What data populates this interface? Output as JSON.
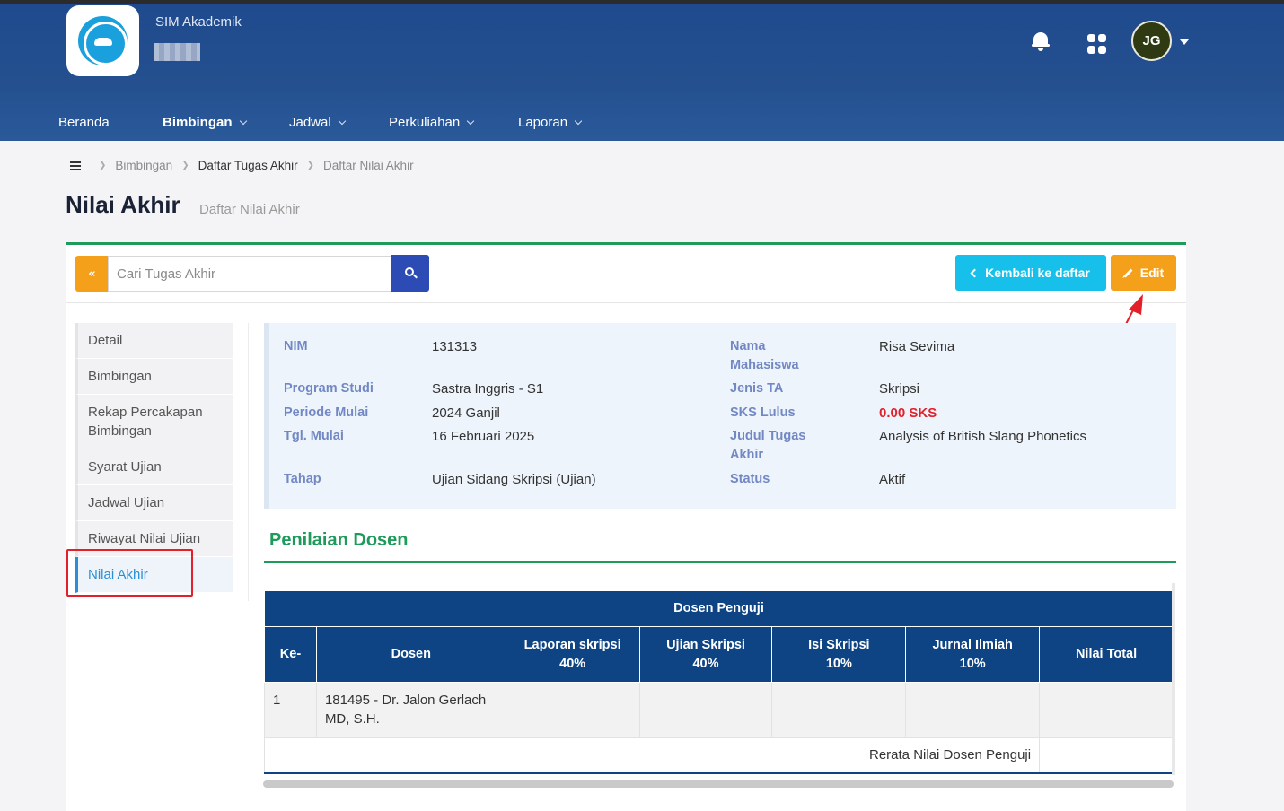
{
  "app": {
    "title": "SIM Akademik",
    "avatar_initials": "JG"
  },
  "nav": {
    "items": [
      {
        "label": "Beranda",
        "has_menu": false,
        "active": false
      },
      {
        "label": "Bimbingan",
        "has_menu": true,
        "active": true
      },
      {
        "label": "Jadwal",
        "has_menu": true,
        "active": false
      },
      {
        "label": "Perkuliahan",
        "has_menu": true,
        "active": false
      },
      {
        "label": "Laporan",
        "has_menu": true,
        "active": false
      }
    ]
  },
  "breadcrumb": {
    "items": [
      "Bimbingan",
      "Daftar Tugas Akhir",
      "Daftar Nilai Akhir"
    ]
  },
  "page": {
    "title": "Nilai Akhir",
    "subtitle": "Daftar Nilai Akhir"
  },
  "toolbar": {
    "search_placeholder": "Cari Tugas Akhir",
    "back_icon": "«",
    "kembali_label": "Kembali ke daftar",
    "edit_label": "Edit"
  },
  "side_menu": {
    "items": [
      "Detail",
      "Bimbingan",
      "Rekap Percakapan Bimbingan",
      "Syarat Ujian",
      "Jadwal Ujian",
      "Riwayat Nilai Ujian",
      "Nilai Akhir"
    ],
    "active": "Nilai Akhir"
  },
  "info": {
    "nim_label": "NIM",
    "nim": "131313",
    "prodi_label": "Program Studi",
    "prodi": "Sastra Inggris - S1",
    "periode_label": "Periode Mulai",
    "periode": "2024 Ganjil",
    "tgl_label": "Tgl. Mulai",
    "tgl": "16 Februari 2025",
    "tahap_label": "Tahap",
    "tahap": "Ujian Sidang Skripsi (Ujian)",
    "nama_label": "Nama Mahasiswa",
    "nama": "Risa Sevima",
    "jenis_label": "Jenis TA",
    "jenis": "Skripsi",
    "sks_label": "SKS Lulus",
    "sks": "0.00 SKS",
    "judul_label": "Judul Tugas Akhir",
    "judul": "Analysis of British Slang Phonetics",
    "status_label": "Status",
    "status": "Aktif"
  },
  "section": {
    "title": "Penilaian Dosen"
  },
  "table": {
    "group_header": "Dosen Penguji",
    "headers": [
      {
        "line1": "Ke-",
        "line2": ""
      },
      {
        "line1": "Dosen",
        "line2": ""
      },
      {
        "line1": "Laporan skripsi",
        "line2": "40%"
      },
      {
        "line1": "Ujian Skripsi",
        "line2": "40%"
      },
      {
        "line1": "Isi Skripsi",
        "line2": "10%"
      },
      {
        "line1": "Jurnal Ilmiah",
        "line2": "10%"
      },
      {
        "line1": "Nilai Total",
        "line2": ""
      }
    ],
    "rows": [
      {
        "ke": "1",
        "dosen": "181495 - Dr. Jalon Gerlach MD, S.H.",
        "laporan": "",
        "ujian": "",
        "isi": "",
        "jurnal": "",
        "total": ""
      }
    ],
    "footer_label": "Rerata Nilai Dosen Penguji",
    "footer_value": ""
  },
  "colors": {
    "primary": "#0e4483",
    "accent_green": "#1e9b5a",
    "orange": "#f5a01a",
    "cyan": "#17c0ea",
    "red": "#e3202a"
  }
}
